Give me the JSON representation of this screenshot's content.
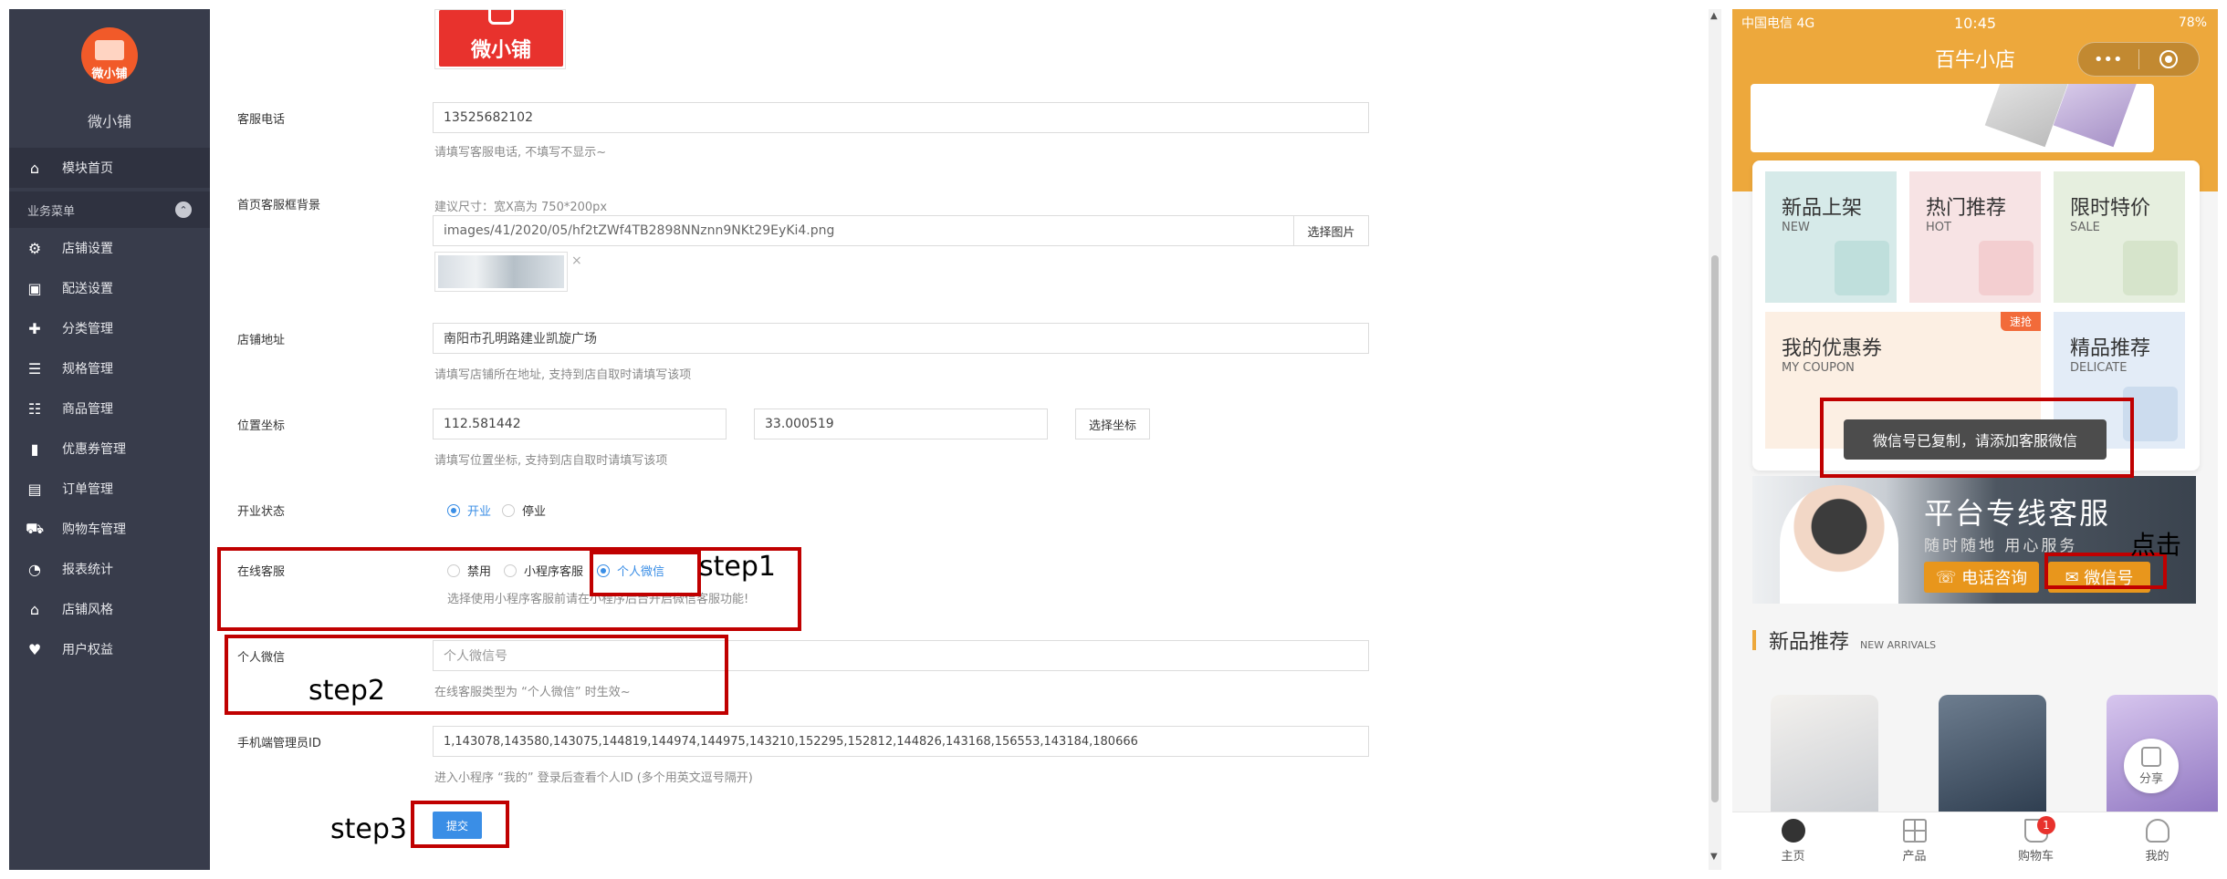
{
  "sidebar": {
    "shop_name": "微小铺",
    "logo_text": "微小铺",
    "section_label": "业务菜单",
    "section_toggle": "⌃",
    "items": [
      {
        "label": "模块首页",
        "icon": "home-icon"
      },
      {
        "label": "店铺设置",
        "icon": "gear-icon"
      },
      {
        "label": "配送设置",
        "icon": "delivery-icon"
      },
      {
        "label": "分类管理",
        "icon": "category-icon"
      },
      {
        "label": "规格管理",
        "icon": "spec-icon"
      },
      {
        "label": "商品管理",
        "icon": "goods-icon"
      },
      {
        "label": "优惠券管理",
        "icon": "coupon-icon"
      },
      {
        "label": "订单管理",
        "icon": "order-icon"
      },
      {
        "label": "购物车管理",
        "icon": "cart-icon"
      },
      {
        "label": "报表统计",
        "icon": "chart-icon"
      },
      {
        "label": "店铺风格",
        "icon": "style-icon"
      },
      {
        "label": "用户权益",
        "icon": "heart-icon"
      }
    ]
  },
  "form": {
    "logo_text": "微小铺",
    "phone_label": "客服电话",
    "phone_value": "13525682102",
    "phone_hint": "请填写客服电话, 不填写不显示~",
    "bg_label": "首页客服框背景",
    "bg_size_hint": "建议尺寸：宽X高为 750*200px",
    "bg_path": "images/41/2020/05/hf2tZWf4TB2898NNznn9NKt29EyKi4.png",
    "bg_button": "选择图片",
    "close_mark": "×",
    "addr_label": "店铺地址",
    "addr_value": "南阳市孔明路建业凯旋广场",
    "addr_hint": "请填写店铺所在地址, 支持到店自取时请填写该项",
    "coord_label": "位置坐标",
    "coord_lng": "112.581442",
    "coord_lat": "33.000519",
    "coord_button": "选择坐标",
    "coord_hint": "请填写位置坐标, 支持到店自取时请填写该项",
    "status_label": "开业状态",
    "status_open": "开业",
    "status_closed": "停业",
    "cs_label": "在线客服",
    "cs_disabled": "禁用",
    "cs_mini": "小程序客服",
    "cs_wechat": "个人微信",
    "cs_hint": "选择使用小程序客服前请在小程序后台开启微信客服功能!",
    "wx_label": "个人微信",
    "wx_placeholder": "个人微信号",
    "wx_hint": "在线客服类型为 “个人微信” 时生效~",
    "admin_label": "手机端管理员ID",
    "admin_value": "1,143078,143580,143075,144819,144974,144975,143210,152295,152812,144826,143168,156553,143184,180666",
    "admin_hint": "进入小程序 “我的” 登录后查看个人ID (多个用英文逗号隔开)",
    "submit_label": "提交"
  },
  "annotations": {
    "step1": "step1",
    "step2": "step2",
    "step3": "step3",
    "click": "点击"
  },
  "phone": {
    "carrier": "中国电信  4G",
    "time": "10:45",
    "battery": "78%",
    "title": "百牛小店",
    "capsule_dots": "•••",
    "categories": [
      {
        "title": "新品上架",
        "sub": "NEW"
      },
      {
        "title": "热门推荐",
        "sub": "HOT"
      },
      {
        "title": "限时特价",
        "sub": "SALE"
      },
      {
        "title": "我的优惠券",
        "sub": "MY COUPON"
      },
      {
        "title": "精品推荐",
        "sub": "DELICATE"
      }
    ],
    "hot_tag": "速抢",
    "toast": "微信号已复制，请添加客服微信",
    "service_title": "平台专线客服",
    "service_sub": "随时随地 用心服务",
    "call_button": "电话咨询",
    "wx_button": "微信号",
    "new_title": "新品推荐",
    "new_sub": "NEW ARRIVALS",
    "share_label": "分享",
    "cart_count": "1",
    "tabs": [
      {
        "label": "主页"
      },
      {
        "label": "产品"
      },
      {
        "label": "购物车"
      },
      {
        "label": "我的"
      }
    ]
  },
  "colors": {
    "sidebar_bg": "#383c4b",
    "accent_blue": "#3a8ee6",
    "annotation_red": "#c00000",
    "phone_header": "#eda83c"
  }
}
